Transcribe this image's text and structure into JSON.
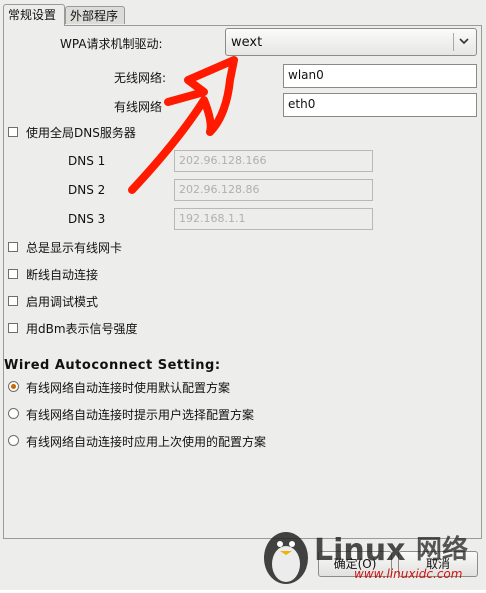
{
  "tabs": [
    "常规设置",
    "外部程序"
  ],
  "wpa": {
    "label": "WPA请求机制驱动:",
    "value": "wext"
  },
  "wireless": {
    "label": "无线网络:",
    "value": "wlan0"
  },
  "wired": {
    "label": "有线网络",
    "value": "eth0"
  },
  "global_dns": {
    "label": "使用全局DNS服务器",
    "checked": false
  },
  "dns": [
    {
      "label": "DNS 1",
      "value": "202.96.128.166"
    },
    {
      "label": "DNS 2",
      "value": "202.96.128.86"
    },
    {
      "label": "DNS 3",
      "value": "192.168.1.1"
    }
  ],
  "options": [
    {
      "label": "总是显示有线网卡",
      "checked": false
    },
    {
      "label": "断线自动连接",
      "checked": false
    },
    {
      "label": "启用调试模式",
      "checked": false
    },
    {
      "label": "用dBm表示信号强度",
      "checked": false
    }
  ],
  "autoconnect": {
    "title": "Wired Autoconnect Setting:",
    "items": [
      {
        "label": "有线网络自动连接时使用默认配置方案",
        "selected": true
      },
      {
        "label": "有线网络自动连接时提示用户选择配置方案",
        "selected": false
      },
      {
        "label": "有线网络自动连接时应用上次使用的配置方案",
        "selected": false
      }
    ]
  },
  "buttons": {
    "ok": "确定(O)",
    "cancel": "取消"
  },
  "watermark": {
    "brand": "Linux",
    "site": "网络",
    "url": "www.linuxidc.com"
  },
  "colors": {
    "annotation_red": "#ff1a00",
    "radio_selected": "#c76a00"
  }
}
